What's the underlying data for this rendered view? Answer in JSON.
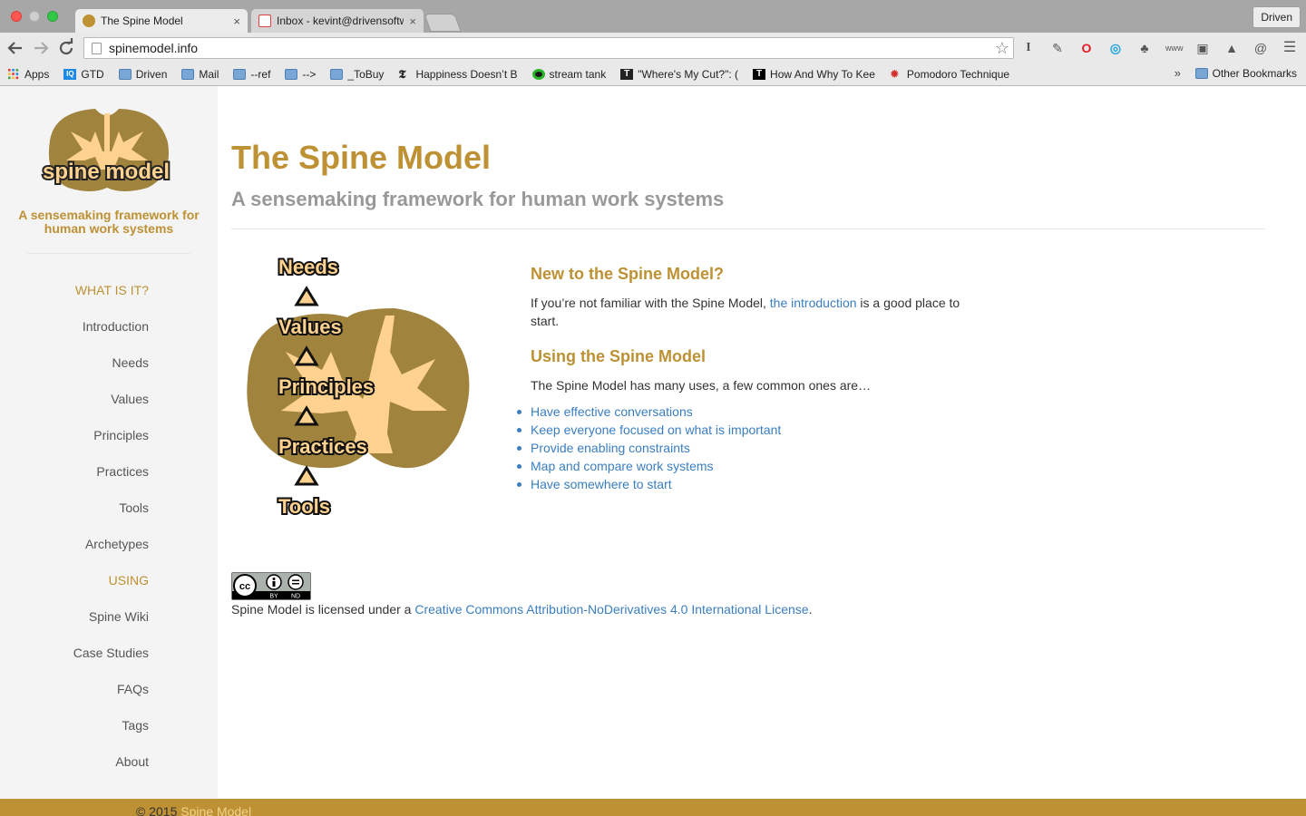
{
  "browser": {
    "tabs": [
      {
        "title": "The Spine Model",
        "active": true
      },
      {
        "title": "Inbox - kevint@drivensoftw",
        "active": false
      }
    ],
    "close_glyph": "×",
    "profile": "Driven",
    "url": "spinemodel.info",
    "bookmarks": [
      {
        "label": "Apps",
        "icon": "apps-grid-icon"
      },
      {
        "label": "GTD",
        "icon": "iq-icon"
      },
      {
        "label": "Driven",
        "icon": "folder-icon"
      },
      {
        "label": "Mail",
        "icon": "folder-icon"
      },
      {
        "label": "--ref",
        "icon": "folder-icon"
      },
      {
        "label": "-->",
        "icon": "folder-icon"
      },
      {
        "label": "_ToBuy",
        "icon": "folder-icon"
      },
      {
        "label": "Happiness Doesn’t B",
        "icon": "nyt-icon"
      },
      {
        "label": "stream tank",
        "icon": "green-dot-icon"
      },
      {
        "label": "\"Where's My Cut?\": (",
        "icon": "t-icon"
      },
      {
        "label": "How And Why To Kee",
        "icon": "t-icon"
      },
      {
        "label": "Pomodoro Technique",
        "icon": "maple-leaf-icon"
      }
    ],
    "more_bookmarks": "»",
    "other_bookmarks": "Other Bookmarks"
  },
  "colors": {
    "brand": "#bd9134",
    "link": "#3a7ec0",
    "sidebar_bg": "#f4f4f4"
  },
  "sidebar": {
    "tagline": "A sensemaking framework for human work systems",
    "menu": [
      {
        "label": "WHAT IS IT?",
        "heading": true
      },
      {
        "label": "Introduction"
      },
      {
        "label": "Needs"
      },
      {
        "label": "Values"
      },
      {
        "label": "Principles"
      },
      {
        "label": "Practices"
      },
      {
        "label": "Tools"
      },
      {
        "label": "Archetypes"
      },
      {
        "label": "USING",
        "heading": true
      },
      {
        "label": "Spine Wiki"
      },
      {
        "label": "Case Studies"
      },
      {
        "label": "FAQs"
      },
      {
        "label": "Tags"
      },
      {
        "label": "About"
      }
    ]
  },
  "main": {
    "title": "The Spine Model",
    "subtitle": "A sensemaking framework for human work systems",
    "logo_text": "spine model",
    "diagram_labels": [
      "Needs",
      "Values",
      "Principles",
      "Practices",
      "Tools"
    ],
    "new_heading": "New to the Spine Model?",
    "new_text_before": "If you’re not familiar with the Spine Model, ",
    "new_link": "the introduction",
    "new_text_after": " is a good place to start.",
    "using_heading": "Using the Spine Model",
    "using_text": "The Spine Model has many uses, a few common ones are…",
    "uses": [
      "Have effective conversations",
      "Keep everyone focused on what is important",
      "Provide enabling constraints",
      "Map and compare work systems",
      "Have somewhere to start"
    ],
    "license_before": "Spine Model is licensed under a ",
    "license_link": "Creative Commons Attribution-NoDerivatives 4.0 International License",
    "license_after": ".",
    "cc_badge": {
      "by": "BY",
      "nd": "ND"
    }
  },
  "footer": {
    "copyright": "© 2015 ",
    "link": "Spine Model"
  }
}
